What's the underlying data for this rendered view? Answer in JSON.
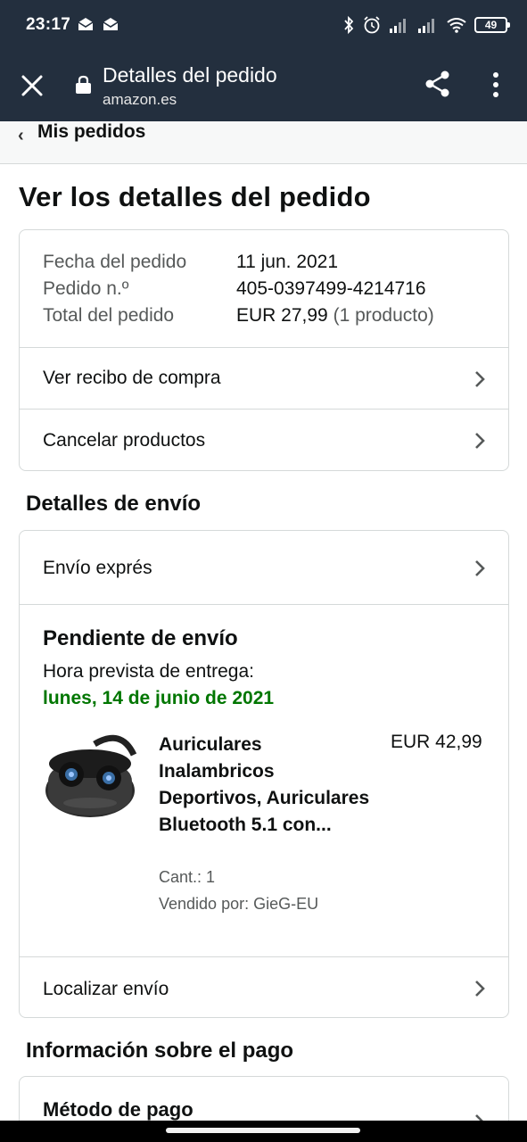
{
  "status_bar": {
    "time": "23:17",
    "battery": "49",
    "icons": [
      "mail-notification-icon",
      "mail-notification-icon",
      "bluetooth-icon",
      "alarm-icon",
      "signal-icon",
      "signal-icon",
      "wifi-icon",
      "battery-icon"
    ]
  },
  "toolbar": {
    "title": "Detalles del pedido",
    "domain": "amazon.es"
  },
  "breadcrumb": {
    "label": "Mis pedidos"
  },
  "page_title": "Ver los detalles del pedido",
  "order_summary": {
    "date_label": "Fecha del pedido",
    "date_value": "11 jun. 2021",
    "number_label": "Pedido n.º",
    "number_value": "405-0397499-4214716",
    "total_label": "Total del pedido",
    "total_value": "EUR 27,99",
    "total_items": "(1 producto)"
  },
  "order_actions": [
    {
      "label": "Ver recibo de compra"
    },
    {
      "label": "Cancelar productos"
    }
  ],
  "shipping": {
    "section_title": "Detalles de envío",
    "method": "Envío exprés",
    "status": "Pendiente de envío",
    "eta_label": "Hora prevista de entrega:",
    "eta_date": "lunes, 14 de junio de 2021",
    "product": {
      "name": "Auriculares Inalambricos Deportivos, Auriculares Bluetooth 5.1 con...",
      "price": "EUR 42,99",
      "quantity": "Cant.: 1",
      "seller": "Vendido por: GieG-EU"
    },
    "track_label": "Localizar envío"
  },
  "payment": {
    "section_title": "Información sobre el pago",
    "method_label": "Método de pago"
  },
  "colors": {
    "header_bg": "#232f3e",
    "delivery_green": "#007600",
    "border": "#d5d9d9"
  }
}
